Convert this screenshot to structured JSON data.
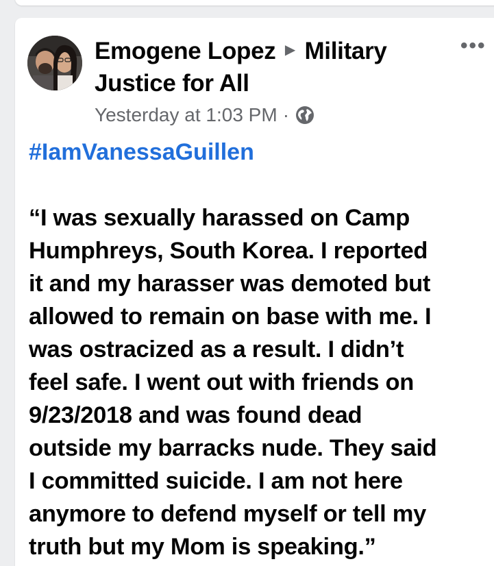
{
  "post": {
    "author": "Emogene Lopez",
    "group_line1": "Military",
    "group_line2": "Justice for All",
    "timestamp": "Yesterday at 1:03 PM",
    "separator": "·",
    "privacy_icon": "globe-icon",
    "more_icon": "more-options-icon",
    "more_glyph": "•••",
    "arrow_glyph": "▶",
    "hashtag": "#IamVanessaGuillen",
    "text_lines": [
      "“I was sexually harassed on Camp",
      "Humphreys, South Korea. I reported",
      "it and my harasser was demoted but",
      "allowed to remain on base with me. I",
      "was ostracized as a result. I didn’t",
      "feel safe. I went out with friends on",
      "9/23/2018 and was found dead",
      "outside my barracks nude. They said",
      "I committed suicide. I am not here",
      "anymore to defend myself or tell my",
      "truth but my Mom is speaking.”"
    ]
  },
  "colors": {
    "text": "#050505",
    "secondary": "#65676b",
    "link": "#216fdb",
    "background": "#edeef0"
  }
}
